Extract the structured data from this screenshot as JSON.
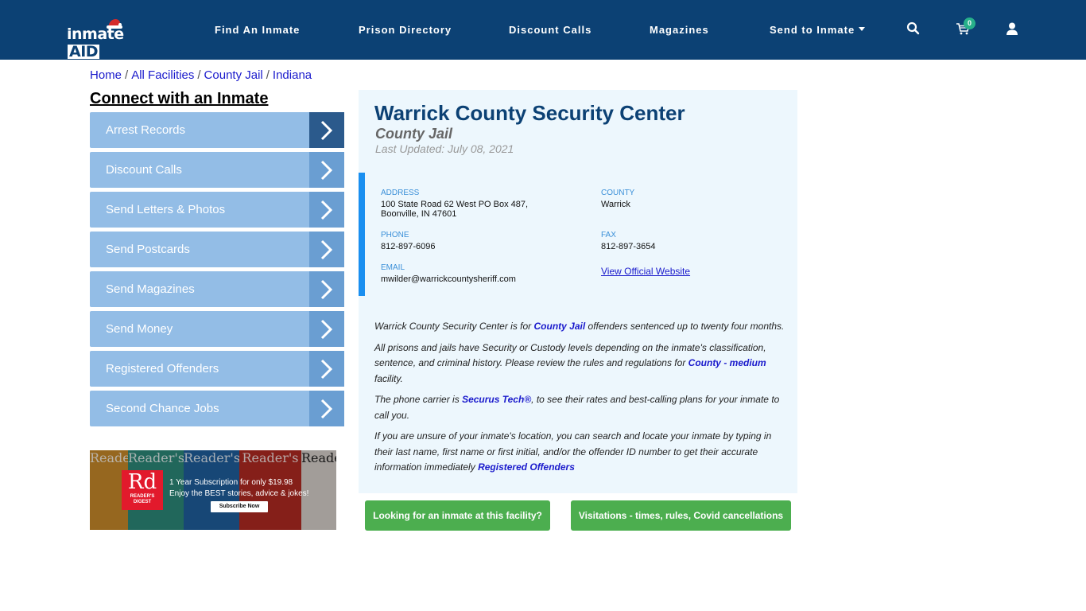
{
  "header": {
    "logo_text": "inmate",
    "logo_accent": "AID",
    "nav": [
      {
        "label": "Find An Inmate"
      },
      {
        "label": "Prison Directory"
      },
      {
        "label": "Discount Calls"
      },
      {
        "label": "Magazines"
      },
      {
        "label": "Send to Inmate",
        "has_dropdown": true
      }
    ],
    "icons": [
      "search-icon",
      "cart-icon",
      "user-icon"
    ],
    "cart_count": "0"
  },
  "breadcrumb": [
    {
      "label": "Home"
    },
    {
      "label": "All Facilities"
    },
    {
      "label": "County Jail"
    },
    {
      "label": "Indiana"
    }
  ],
  "breadcrumb_separator": "/",
  "sidebar": {
    "title": "Connect with an Inmate",
    "items": [
      {
        "label": "Arrest Records"
      },
      {
        "label": "Discount Calls"
      },
      {
        "label": "Send Letters & Photos"
      },
      {
        "label": "Send Postcards"
      },
      {
        "label": "Send Magazines"
      },
      {
        "label": "Send Money"
      },
      {
        "label": "Registered Offenders"
      },
      {
        "label": "Second Chance Jobs"
      }
    ]
  },
  "ad": {
    "brand_short": "Rd",
    "brand_name": "READER'S DIGEST",
    "cover_title": "Reader's",
    "line1": "1 Year Subscription for only $19.98",
    "line2": "Enjoy the BEST stories, advice & jokes!",
    "cta": "Subscribe Now"
  },
  "facility": {
    "name": "Warrick County Security Center",
    "type": "County Jail",
    "last_updated": "Last Updated: July 08, 2021",
    "address_label": "ADDRESS",
    "address_line1": "100 State Road 62 West PO Box 487,",
    "address_line2": "Boonville, IN 47601",
    "county_label": "COUNTY",
    "county": "Warrick",
    "phone_label": "PHONE",
    "phone": "812-897-6096",
    "fax_label": "FAX",
    "fax": "812-897-3654",
    "email_label": "EMAIL",
    "email": "mwilder@warrickcountysheriff.com",
    "website_link": "View Official Website"
  },
  "description": {
    "p1_a": "Warrick County Security Center is for ",
    "p1_link": "County Jail",
    "p1_b": " offenders sentenced up to twenty four months.",
    "p2_a": "All prisons and jails have Security or Custody levels depending on the inmate's classification, sentence, and criminal history. Please review the rules and regulations for ",
    "p2_link": "County - medium",
    "p2_b": " facility.",
    "p3_a": "The phone carrier is ",
    "p3_link": "Securus Tech®",
    "p3_b": ", to see their rates and best-calling plans for your inmate to call you.",
    "p4_a": "If you are unsure of your inmate's location, you can search and locate your inmate by typing in their last name, first name or first initial, and/or the offender ID number to get their accurate information immediately ",
    "p4_link": "Registered Offenders"
  },
  "buttons": {
    "find_inmate": "Looking for an inmate at this facility?",
    "visitations": "Visitations - times, rules, Covid cancellations"
  },
  "colors": {
    "header_bg": "#0c4174",
    "sidebar_item": "#93bde6",
    "sidebar_arrow": "#6a9ed2",
    "sidebar_arrow_active": "#2b5a8c",
    "panel_bg": "#edf7fd",
    "accent_bar": "#1a8ff0",
    "button_green": "#4cae4f",
    "link": "#1a1acc"
  }
}
